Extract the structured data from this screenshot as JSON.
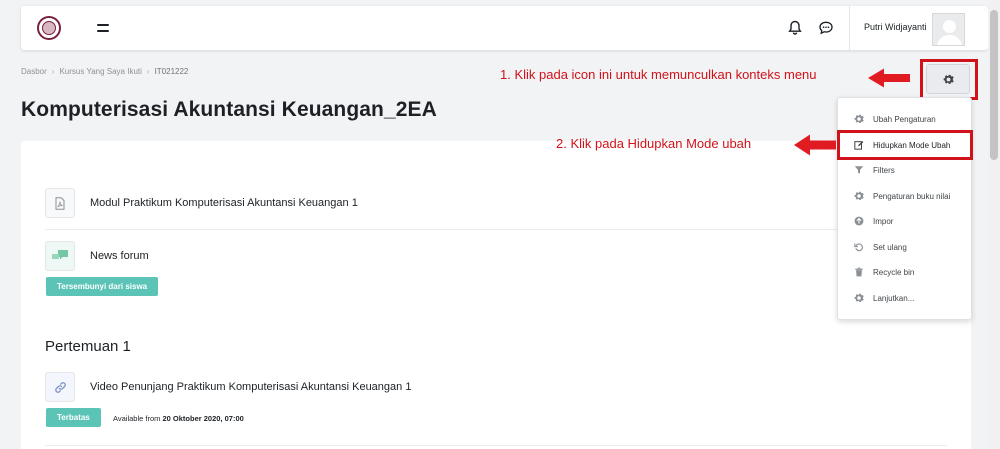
{
  "navbar": {
    "logo_icon": "university-seal-icon",
    "menu_icon": "hamburger-icon",
    "notifications_icon": "bell-icon",
    "messages_icon": "chat-icon",
    "user_name": "Putri Widjayanti"
  },
  "breadcrumb": {
    "items": [
      "Dasbor",
      "Kursus Yang Saya Ikuti",
      "IT021222"
    ],
    "separator": "›"
  },
  "page_title": "Komputerisasi Akuntansi Keuangan_2EA",
  "settings_button": {
    "icon": "gear-icon"
  },
  "course": {
    "activities": [
      {
        "label": "Modul Praktikum Komputerisasi Akuntansi Keuangan 1",
        "icon": "file-pdf-icon"
      },
      {
        "label": "News forum",
        "icon": "forum-icon",
        "badge": "Tersembunyi dari siswa"
      }
    ],
    "section": {
      "title": "Pertemuan 1",
      "activity": {
        "label": "Video Penunjang Praktikum Komputerisasi Akuntansi Keuangan 1",
        "icon": "link-icon",
        "badge": "Terbatas",
        "availability_prefix": "Available from",
        "availability_date": "20 Oktober 2020, 07:00"
      }
    }
  },
  "context_menu": {
    "items": [
      {
        "label": "Ubah Pengaturan",
        "icon": "gear-icon"
      },
      {
        "label": "Hidupkan Mode Ubah",
        "icon": "edit-icon"
      },
      {
        "label": "Filters",
        "icon": "filter-icon"
      },
      {
        "label": "Pengaturan buku nilai",
        "icon": "gear-icon"
      },
      {
        "label": "Impor",
        "icon": "upload-icon"
      },
      {
        "label": "Set ulang",
        "icon": "undo-icon"
      },
      {
        "label": "Recycle bin",
        "icon": "trash-icon"
      },
      {
        "label": "Lanjutkan...",
        "icon": "gear-icon"
      }
    ]
  },
  "annotations": {
    "step1": "1. Klik pada icon ini untuk memunculkan konteks menu",
    "step2": "2. Klik pada Hidupkan Mode ubah",
    "color": "#d1121a"
  },
  "colors": {
    "badge": "#5bc4b7",
    "background": "#f2f3f5",
    "logo": "#7a1f3d"
  }
}
